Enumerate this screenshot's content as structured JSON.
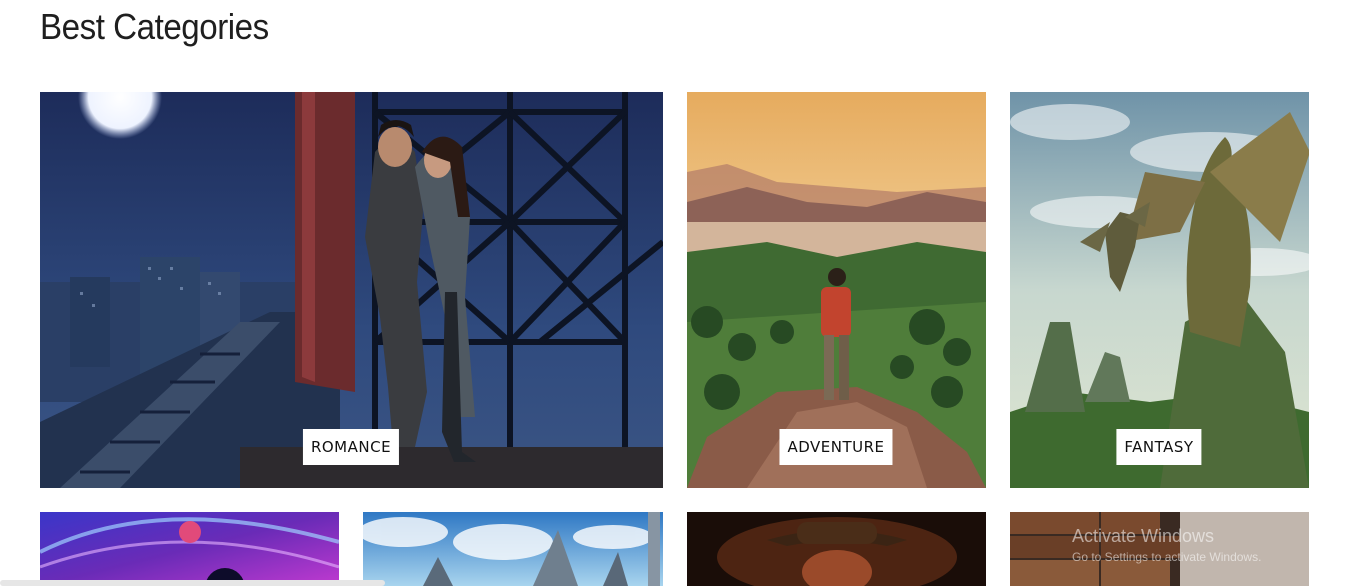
{
  "section": {
    "title": "Best Categories"
  },
  "categories": [
    {
      "label": "ROMANCE",
      "image": "couple-on-tower-at-night"
    },
    {
      "label": "ADVENTURE",
      "image": "hiker-on-mountain-valley"
    },
    {
      "label": "FANTASY",
      "image": "dragons-on-rock-pillars"
    }
  ],
  "second_row": [
    {
      "image": "galaxy-nebula-planet"
    },
    {
      "image": "sci-fi-city-spires"
    },
    {
      "image": "cowboy-hat-western"
    },
    {
      "image": "old-books-stack"
    }
  ],
  "watermark": {
    "line1": "Activate Windows",
    "line2": "Go to Settings to activate Windows."
  }
}
